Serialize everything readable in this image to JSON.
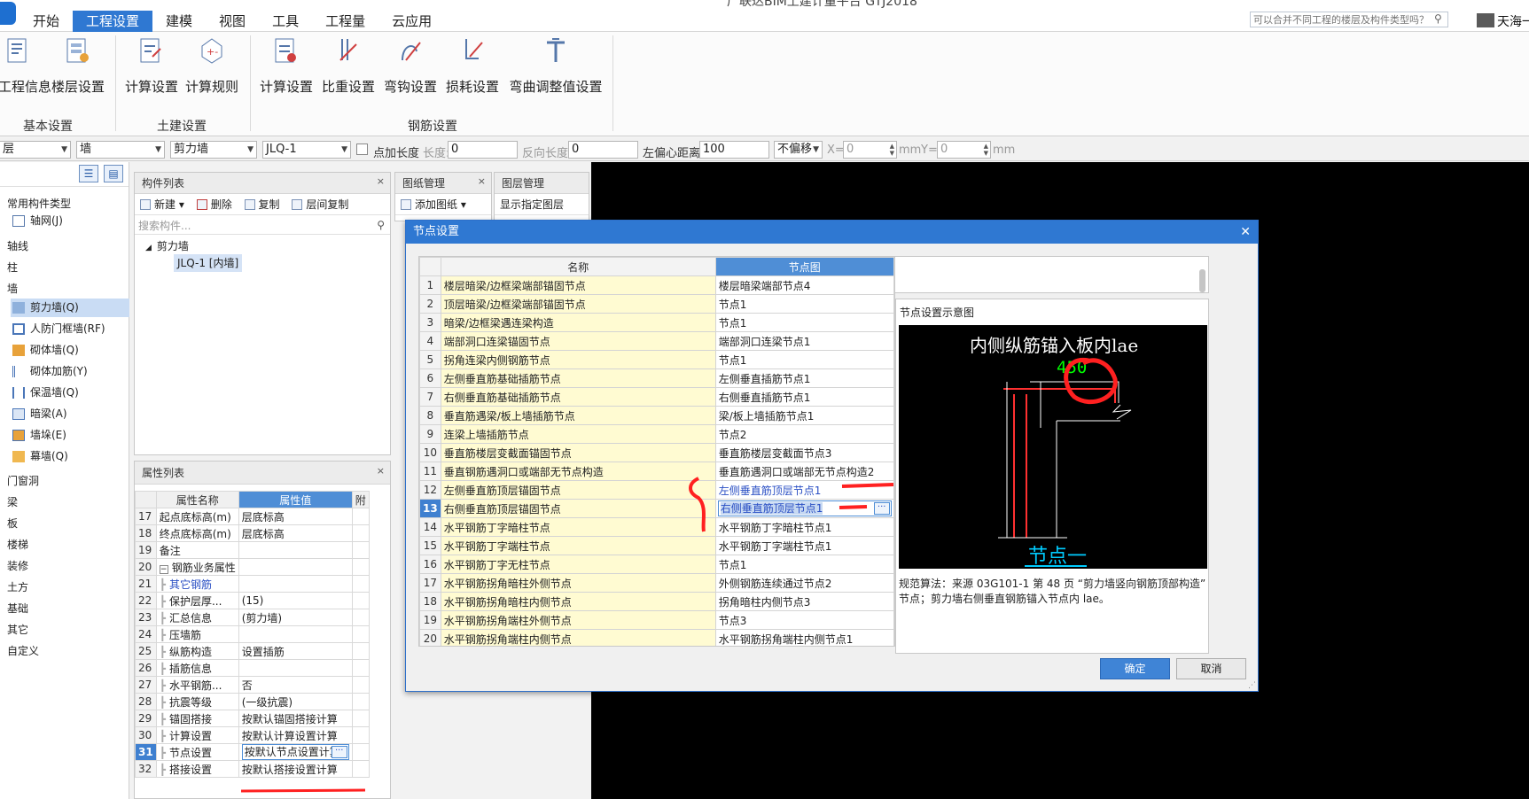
{
  "titlebar": {
    "window_title": "广联达BIM土建计量平台 GTJ2018",
    "menu_tabs": [
      "开始",
      "工程设置",
      "建模",
      "视图",
      "工具",
      "工程量",
      "云应用"
    ],
    "active_tab": "工程设置",
    "help_search_placeholder": "可以合并不同工程的楼层及构件类型吗？",
    "user_name": "天海一"
  },
  "ribbon": {
    "basic_settings": {
      "group": "基本设置",
      "project_info": "工程信息",
      "floor_settings": "楼层设置"
    },
    "civil_settings": {
      "group": "土建设置",
      "calc_settings": "计算设置",
      "calc_rules": "计算规则"
    },
    "rebar_settings": {
      "group": "钢筋设置",
      "calc_settings": "计算设置",
      "weight_settings": "比重设置",
      "hook_settings": "弯钩设置",
      "loss_settings": "损耗设置",
      "bend_adjust": "弯曲调整值设置"
    }
  },
  "prop_toolbar": {
    "floor": "层",
    "type": "墙",
    "subtype": "剪力墙",
    "component": "JLQ-1",
    "add_length_label": "点加长度",
    "length_label": "长度:",
    "length_value": "0",
    "reverse_length_label": "反向长度:",
    "reverse_length_value": "0",
    "offset_label": "左偏心距离:",
    "offset_value": "100",
    "offset_mode": "不偏移",
    "x_label": "X=",
    "x_value": "0",
    "x_unit": "mm",
    "y_label": "Y=",
    "y_value": "0",
    "y_unit": "mm"
  },
  "left_nav": {
    "common": "常用构件类型",
    "axis_grid": "轴网(J)",
    "axis_line": "轴线",
    "column": "柱",
    "wall": "墙",
    "wall_items": [
      "剪力墙(Q)",
      "人防门框墙(RF)",
      "砌体墙(Q)",
      "砌体加筋(Y)",
      "保温墙(Q)",
      "暗梁(A)",
      "墙垛(E)",
      "幕墙(Q)"
    ],
    "selected_wall_item": "剪力墙(Q)",
    "others": [
      "门窗洞",
      "梁",
      "板",
      "楼梯",
      "装修",
      "土方",
      "基础",
      "其它",
      "自定义"
    ]
  },
  "component_list": {
    "title": "构件列表",
    "tools": [
      "新建",
      "删除",
      "复制",
      "层间复制"
    ],
    "search_placeholder": "搜索构件...",
    "tree_root": "剪力墙",
    "tree_leaf": "JLQ-1 [内墙]"
  },
  "drawing_mgmt": {
    "title": "图纸管理",
    "add": "添加图纸"
  },
  "layer_mgmt": {
    "title": "图层管理",
    "show": "显示指定图层"
  },
  "property_list": {
    "title": "属性列表",
    "headers": [
      "属性名称",
      "属性值",
      "附"
    ],
    "rows": [
      {
        "num": "17",
        "name": "起点底标高(m)",
        "value": "层底标高",
        "indent": false
      },
      {
        "num": "18",
        "name": "终点底标高(m)",
        "value": "层底标高",
        "indent": false
      },
      {
        "num": "19",
        "name": "备注",
        "value": "",
        "indent": false
      },
      {
        "num": "20",
        "name": "钢筋业务属性",
        "value": "",
        "group": true
      },
      {
        "num": "21",
        "name": "其它钢筋",
        "value": "",
        "indent": true,
        "link": true
      },
      {
        "num": "22",
        "name": "保护层厚...",
        "value": "(15)",
        "indent": true
      },
      {
        "num": "23",
        "name": "汇总信息",
        "value": "(剪力墙)",
        "indent": true
      },
      {
        "num": "24",
        "name": "压墙筋",
        "value": "",
        "indent": true
      },
      {
        "num": "25",
        "name": "纵筋构造",
        "value": "设置插筋",
        "indent": true
      },
      {
        "num": "26",
        "name": "插筋信息",
        "value": "",
        "indent": true
      },
      {
        "num": "27",
        "name": "水平钢筋...",
        "value": "否",
        "indent": true
      },
      {
        "num": "28",
        "name": "抗震等级",
        "value": "(一级抗震)",
        "indent": true
      },
      {
        "num": "29",
        "name": "锚固搭接",
        "value": "按默认锚固搭接计算",
        "indent": true
      },
      {
        "num": "30",
        "name": "计算设置",
        "value": "按默认计算设置计算",
        "indent": true
      },
      {
        "num": "31",
        "name": "节点设置",
        "value": "按默认节点设置计算",
        "indent": true,
        "selected": true
      },
      {
        "num": "32",
        "name": "搭接设置",
        "value": "按默认搭接设置计算",
        "indent": true
      }
    ]
  },
  "dialog": {
    "title": "节点设置",
    "headers": [
      "名称",
      "节点图"
    ],
    "rows": [
      {
        "num": "1",
        "name": "楼层暗梁/边框梁端部锚固节点",
        "node": "楼层暗梁端部节点4"
      },
      {
        "num": "2",
        "name": "顶层暗梁/边框梁端部锚固节点",
        "node": "节点1"
      },
      {
        "num": "3",
        "name": "暗梁/边框梁遇连梁构造",
        "node": "节点1"
      },
      {
        "num": "4",
        "name": "端部洞口连梁锚固节点",
        "node": "端部洞口连梁节点1"
      },
      {
        "num": "5",
        "name": "拐角连梁内侧钢筋节点",
        "node": "节点1"
      },
      {
        "num": "6",
        "name": "左侧垂直筋基础插筋节点",
        "node": "左侧垂直插筋节点1"
      },
      {
        "num": "7",
        "name": "右侧垂直筋基础插筋节点",
        "node": "右侧垂直插筋节点1"
      },
      {
        "num": "8",
        "name": "垂直筋遇梁/板上墙插筋节点",
        "node": "梁/板上墙插筋节点1"
      },
      {
        "num": "9",
        "name": "连梁上墙插筋节点",
        "node": "节点2"
      },
      {
        "num": "10",
        "name": "垂直筋楼层变截面锚固节点",
        "node": "垂直筋楼层变截面节点3"
      },
      {
        "num": "11",
        "name": "垂直钢筋遇洞口或端部无节点构造",
        "node": "垂直筋遇洞口或端部无节点构造2"
      },
      {
        "num": "12",
        "name": "左侧垂直筋顶层锚固节点",
        "node": "左侧垂直筋顶层节点1",
        "blue": true
      },
      {
        "num": "13",
        "name": "右侧垂直筋顶层锚固节点",
        "node": "右侧垂直筋顶层节点1",
        "selected": true
      },
      {
        "num": "14",
        "name": "水平钢筋丁字暗柱节点",
        "node": "水平钢筋丁字暗柱节点1"
      },
      {
        "num": "15",
        "name": "水平钢筋丁字端柱节点",
        "node": "水平钢筋丁字端柱节点1"
      },
      {
        "num": "16",
        "name": "水平钢筋丁字无柱节点",
        "node": "节点1"
      },
      {
        "num": "17",
        "name": "水平钢筋拐角暗柱外侧节点",
        "node": "外侧钢筋连续通过节点2"
      },
      {
        "num": "18",
        "name": "水平钢筋拐角暗柱内侧节点",
        "node": "拐角暗柱内侧节点3"
      },
      {
        "num": "19",
        "name": "水平钢筋拐角端柱外侧节点",
        "node": "节点3"
      },
      {
        "num": "20",
        "name": "水平钢筋拐角端柱内侧节点",
        "node": "水平钢筋拐角端柱内侧节点1"
      }
    ],
    "ellipsis": "···",
    "preview_label": "节点设置示意图",
    "preview_caption": "内侧纵筋锚入板内lae",
    "preview_value": "450",
    "preview_node_name": "节点一",
    "description": "规范算法：来源 03G101-1 第 48 页 “剪力墙竖向钢筋顶部构造” 节点；剪力墙右侧垂直钢筋锚入节点内 lae。",
    "ok": "确定",
    "cancel": "取消"
  },
  "colors": {
    "accent": "#2f78d2",
    "name_cell": "#fffbd2",
    "annotation": "#ff2020",
    "cad_green": "#00ff00",
    "cad_cyan": "#00ccff"
  }
}
